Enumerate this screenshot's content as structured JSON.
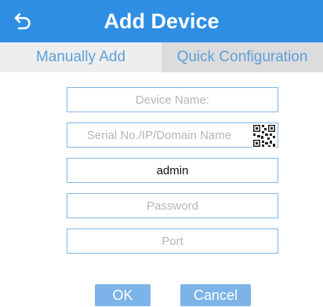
{
  "header": {
    "title": "Add Device",
    "back_icon": "back-arrow-icon"
  },
  "tabs": [
    {
      "label": "Manually Add",
      "active": true
    },
    {
      "label": "Quick Configuration",
      "active": false
    }
  ],
  "form": {
    "device_name": {
      "placeholder": "Device Name:",
      "value": ""
    },
    "serial": {
      "placeholder": "Serial No./IP/Domain Name",
      "value": "",
      "icon": "qr-code-icon"
    },
    "username": {
      "placeholder": "",
      "value": "admin"
    },
    "password": {
      "placeholder": "Password",
      "value": ""
    },
    "port": {
      "placeholder": "Port",
      "value": ""
    }
  },
  "buttons": {
    "ok_label": "OK",
    "cancel_label": "Cancel"
  },
  "colors": {
    "header": "#2e8ee3",
    "tab_text": "#5e9fda",
    "field_border": "#7fb5e6",
    "button": "#7cb3e8"
  }
}
